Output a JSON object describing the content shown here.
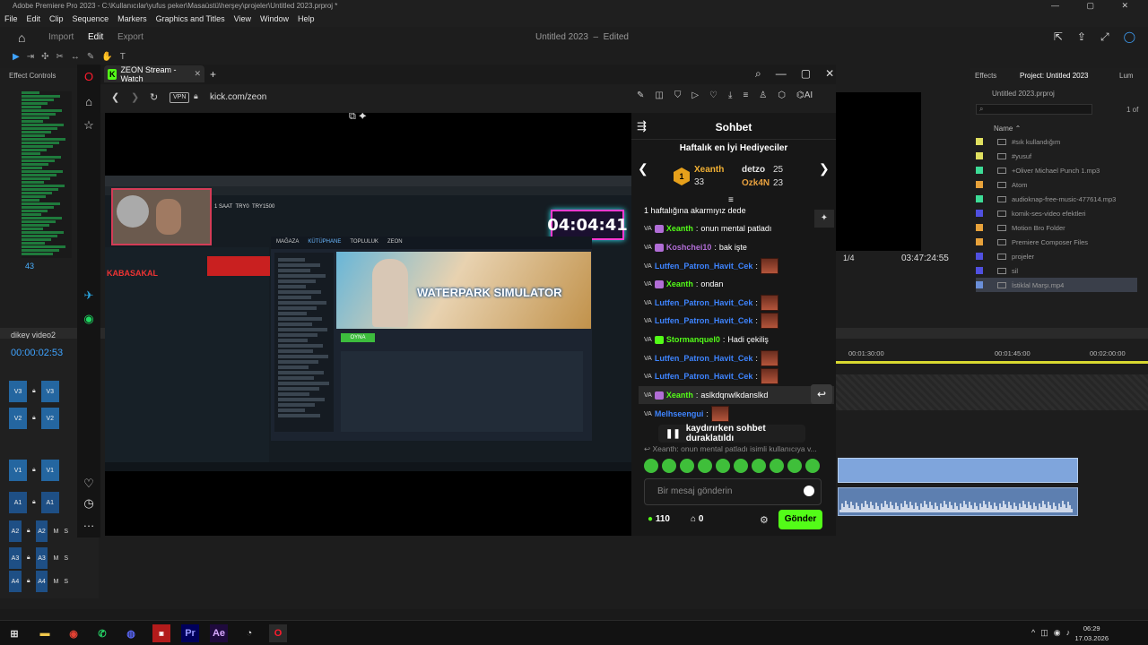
{
  "premiere": {
    "title": "Adobe Premiere Pro 2023 - C:\\Kullanıcılar\\yufus peker\\Masaüstü\\herşey\\projeler\\Untitled 2023.prproj *",
    "menu": [
      "File",
      "Edit",
      "Clip",
      "Sequence",
      "Markers",
      "Graphics and Titles",
      "View",
      "Window",
      "Help"
    ],
    "workspace_tabs": [
      "Import",
      "Edit",
      "Export"
    ],
    "active_workspace": "Edit",
    "project_name": "Untitled 2023",
    "project_state": "Edited",
    "effect_controls_label": "Effect Controls",
    "meter_value": "43",
    "right_tabs": [
      "Effects",
      "Project: Untitled 2023",
      "Lum"
    ],
    "project_file": "Untitled 2023.prproj",
    "page_count": "1 of",
    "name_header": "Name",
    "bin_items": [
      {
        "name": "#sık kullandığım",
        "color": "#e0e060"
      },
      {
        "name": "#yusuf",
        "color": "#e0e060"
      },
      {
        "name": "+Oliver Michael   Punch 1.mp3",
        "color": "#3ddc97"
      },
      {
        "name": "Atom",
        "color": "#e8a23b"
      },
      {
        "name": "audioknap-free-music-477614.mp3",
        "color": "#3ddc97"
      },
      {
        "name": "komik-ses-video efektleri",
        "color": "#5050e0"
      },
      {
        "name": "Motion Bro Folder",
        "color": "#e8a23b"
      },
      {
        "name": "Premiere Composer Files",
        "color": "#e8a23b"
      },
      {
        "name": "projeler",
        "color": "#5050e0"
      },
      {
        "name": "sil",
        "color": "#5050e0"
      },
      {
        "name": "İstiklal Marşı.mp4",
        "color": "#6a8fd8"
      }
    ],
    "program_fraction": "1/4",
    "program_timecode": "03:47:24:55",
    "sequence_name": "dikey video2",
    "sequence_timecode": "00:00:02:53",
    "ruler_marks": [
      "00:01:30:00",
      "00:01:45:00",
      "00:02:00:00"
    ],
    "tracks": [
      "V3",
      "V2",
      "V1",
      "A1",
      "A2",
      "A3",
      "A4"
    ],
    "track_mute": "M",
    "track_solo": "S"
  },
  "browser": {
    "tab_title": "ZEON Stream - Watch",
    "url": "kick.com/zeon",
    "vpn_label": "VPN",
    "ai_label": "AI"
  },
  "stream": {
    "timer": "04:04:41",
    "game_title": "WATERPARK SIMULATOR",
    "store_tabs": [
      "MAĞAZA",
      "KÜTÜPHANE",
      "TOPLULUK",
      "ZEON"
    ],
    "kick_label": "KABASAKAL",
    "overlay_counts": [
      "1 SAAT",
      "TRY0",
      "TRY1500"
    ],
    "play_label": "OYNA"
  },
  "chat": {
    "title": "Sohbet",
    "gifters_title": "Haftalık en İyi Hediyeciler",
    "gifters": [
      {
        "name": "Xeanth",
        "count": "33",
        "color": "#f2b134"
      },
      {
        "name": "detzo",
        "count": "25",
        "color": "#e6e6e6"
      },
      {
        "name": "Ozk4N",
        "count": "23",
        "color": "#e8a13f"
      }
    ],
    "rank_badge": "1",
    "pinned": "1 haftalığına akarmıyız dede",
    "messages": [
      {
        "user": "Xeanth",
        "color": "#53fc18",
        "text": "onun mental patladı",
        "emote": false
      },
      {
        "user": "Koshchei10",
        "color": "#b16dd6",
        "text": "bak işte",
        "emote": false
      },
      {
        "user": "Lutfen_Patron_Havit_Cek",
        "color": "#3e84ff",
        "text": "",
        "emote": true
      },
      {
        "user": "Xeanth",
        "color": "#53fc18",
        "text": "ondan",
        "emote": false
      },
      {
        "user": "Lutfen_Patron_Havit_Cek",
        "color": "#3e84ff",
        "text": "",
        "emote": true
      },
      {
        "user": "Lutfen_Patron_Havit_Cek",
        "color": "#3e84ff",
        "text": "",
        "emote": true
      },
      {
        "user": "Stormanquel0",
        "color": "#53fc18",
        "text": "Hadi çekiliş",
        "emote": false
      },
      {
        "user": "Lutfen_Patron_Havit_Cek",
        "color": "#3e84ff",
        "text": "",
        "emote": true
      },
      {
        "user": "Lutfen_Patron_Havit_Cek",
        "color": "#3e84ff",
        "text": "",
        "emote": true
      },
      {
        "user": "Xeanth",
        "color": "#53fc18",
        "text": "aslkdqnwlkdanslkd",
        "emote": false
      },
      {
        "user": "Melhseengui",
        "color": "#3e84ff",
        "text": "",
        "emote": true
      }
    ],
    "paused_label": "kaydırırken sohbet duraklatıldı",
    "reply_preview": "Xeanth: onun mental patladı isimli kullanıcıya v...",
    "input_placeholder": "Bir mesaj gönderin",
    "points": "110",
    "drops": "0",
    "send_label": "Gönder",
    "accent": "#53fc18"
  },
  "taskbar": {
    "time": "06:29",
    "date": "17.03.2026"
  }
}
